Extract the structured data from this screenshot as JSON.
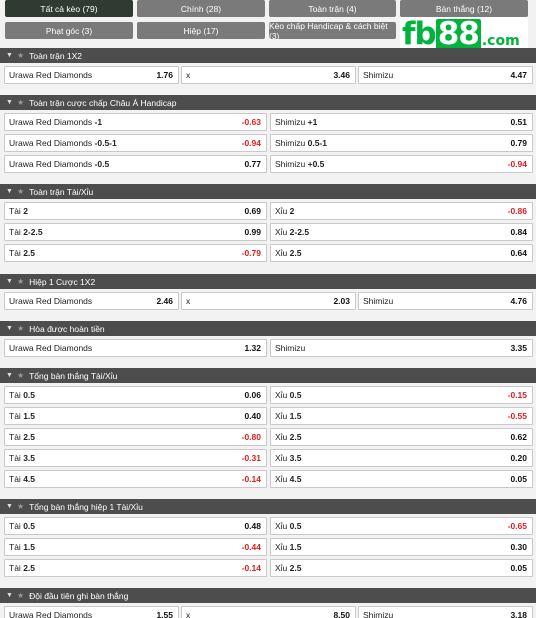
{
  "tabs": [
    {
      "label": "Tất cả kèo (79)",
      "active": true
    },
    {
      "label": "Chính (28)"
    },
    {
      "label": "Toàn trận (4)"
    },
    {
      "label": "Bàn thắng (12)"
    },
    {
      "label": "Phạt góc (3)"
    },
    {
      "label": "Hiệp (17)"
    },
    {
      "label": "Kèo chấp Handicap & cách biệt (3)"
    }
  ],
  "logo": {
    "text_a": "fb",
    "text_b": "88",
    "text_c": ".com"
  },
  "sections": [
    {
      "title": "Toàn trận 1X2"
    },
    {
      "title": "Toàn trận cược chấp Châu Á Handicap"
    },
    {
      "title": "Toàn trận Tài/Xỉu"
    },
    {
      "title": "Hiệp 1 Cược 1X2"
    },
    {
      "title": "Hòa được hoàn tiền"
    },
    {
      "title": "Tổng bàn thắng Tài/Xỉu"
    },
    {
      "title": "Tổng bàn thắng hiệp 1 Tài/Xỉu"
    },
    {
      "title": "Đội đầu tiên ghi bàn thắng"
    }
  ],
  "s1": [
    {
      "label": "Urawa Red Diamonds",
      "odd": "1.76"
    },
    {
      "label": "x",
      "odd": "3.46"
    },
    {
      "label": "Shimizu",
      "odd": "4.47"
    }
  ],
  "s2": [
    {
      "label": "Urawa Red Diamonds",
      "line": "-1",
      "odd": "-0.63"
    },
    {
      "label": "Shimizu",
      "line": "+1",
      "odd": "0.51"
    },
    {
      "label": "Urawa Red Diamonds",
      "line": "-0.5-1",
      "odd": "-0.94"
    },
    {
      "label": "Shimizu",
      "line": "0.5-1",
      "odd": "0.79"
    },
    {
      "label": "Urawa Red Diamonds",
      "line": "-0.5",
      "odd": "0.77"
    },
    {
      "label": "Shimizu",
      "line": "+0.5",
      "odd": "-0.94"
    }
  ],
  "s3": [
    {
      "label": "Tài",
      "line": "2",
      "odd": "0.69"
    },
    {
      "label": "Xỉu",
      "line": "2",
      "odd": "-0.86"
    },
    {
      "label": "Tài",
      "line": "2-2.5",
      "odd": "0.99"
    },
    {
      "label": "Xỉu",
      "line": "2-2.5",
      "odd": "0.84"
    },
    {
      "label": "Tài",
      "line": "2.5",
      "odd": "-0.79"
    },
    {
      "label": "Xỉu",
      "line": "2.5",
      "odd": "0.64"
    }
  ],
  "s4": [
    {
      "label": "Urawa Red Diamonds",
      "odd": "2.46"
    },
    {
      "label": "x",
      "odd": "2.03"
    },
    {
      "label": "Shimizu",
      "odd": "4.76"
    }
  ],
  "s5": [
    {
      "label": "Urawa Red Diamonds",
      "odd": "1.32"
    },
    {
      "label": "Shimizu",
      "odd": "3.35"
    }
  ],
  "s6": [
    {
      "label": "Tài",
      "line": "0.5",
      "odd": "0.06"
    },
    {
      "label": "Xỉu",
      "line": "0.5",
      "odd": "-0.15"
    },
    {
      "label": "Tài",
      "line": "1.5",
      "odd": "0.40"
    },
    {
      "label": "Xỉu",
      "line": "1.5",
      "odd": "-0.55"
    },
    {
      "label": "Tài",
      "line": "2.5",
      "odd": "-0.80"
    },
    {
      "label": "Xỉu",
      "line": "2.5",
      "odd": "0.62"
    },
    {
      "label": "Tài",
      "line": "3.5",
      "odd": "-0.31"
    },
    {
      "label": "Xỉu",
      "line": "3.5",
      "odd": "0.20"
    },
    {
      "label": "Tài",
      "line": "4.5",
      "odd": "-0.14"
    },
    {
      "label": "Xỉu",
      "line": "4.5",
      "odd": "0.05"
    }
  ],
  "s7": [
    {
      "label": "Tài",
      "line": "0.5",
      "odd": "0.48"
    },
    {
      "label": "Xỉu",
      "line": "0.5",
      "odd": "-0.65"
    },
    {
      "label": "Tài",
      "line": "1.5",
      "odd": "-0.44"
    },
    {
      "label": "Xỉu",
      "line": "1.5",
      "odd": "0.30"
    },
    {
      "label": "Tài",
      "line": "2.5",
      "odd": "-0.14"
    },
    {
      "label": "Xỉu",
      "line": "2.5",
      "odd": "0.05"
    }
  ],
  "s8": [
    {
      "label": "Urawa Red Diamonds",
      "odd": "1.55"
    },
    {
      "label": "x",
      "odd": "8.50"
    },
    {
      "label": "Shimizu",
      "odd": "3.18"
    }
  ],
  "colors": {
    "negative": "#d92020",
    "header": "#4d4d4d",
    "tab": "#7a7a7a",
    "tab_active": "#2f3a33",
    "brand": "#00b33c"
  }
}
